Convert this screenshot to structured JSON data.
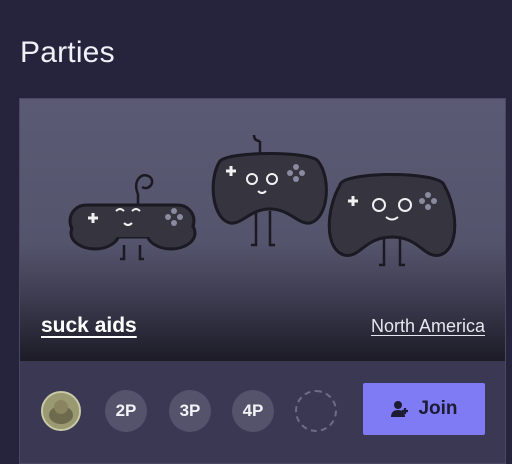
{
  "section": {
    "title": "Parties"
  },
  "party": {
    "name": "suck aids",
    "region": "North America",
    "slots": [
      "2P",
      "3P",
      "4P"
    ],
    "join_label": "Join"
  },
  "icons": {
    "avatar": "user-avatar",
    "join": "add-user-icon",
    "banner": "game-controllers-illustration"
  },
  "colors": {
    "background": "#26243d",
    "card": "#3a3853",
    "accent": "#7f7bf5"
  }
}
